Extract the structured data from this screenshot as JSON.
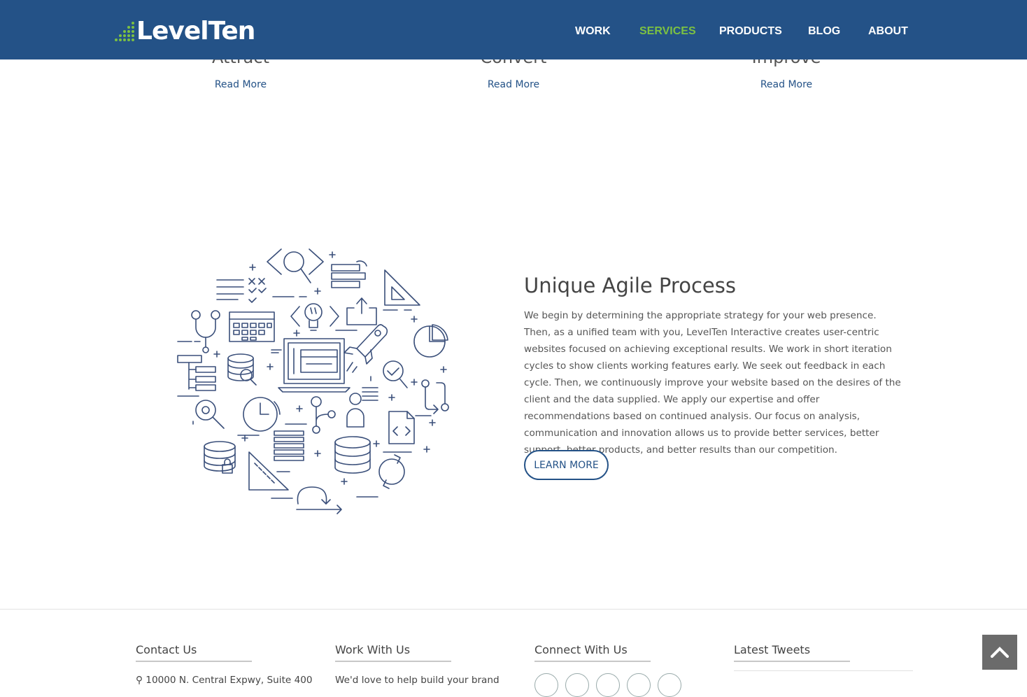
{
  "header": {
    "logo_text": "LevelTen",
    "nav": [
      {
        "label": "WORK",
        "active": false
      },
      {
        "label": "SERVICES",
        "active": true
      },
      {
        "label": "PRODUCTS",
        "active": false
      },
      {
        "label": "BLOG",
        "active": false
      },
      {
        "label": "ABOUT",
        "active": false
      }
    ],
    "active_color": "#7cc142",
    "background": "#245287"
  },
  "services": [
    {
      "title": "Attract",
      "link": "Read More"
    },
    {
      "title": "Convert",
      "link": "Read More"
    },
    {
      "title": "Improve",
      "link": "Read More"
    }
  ],
  "agile": {
    "title": "Unique Agile Process",
    "body": "We begin by determining the appropriate strategy for your web presence. Then, as a unified team with you, LevelTen Interactive creates user-centric websites focused on achieving exceptional results. We work in short iteration cycles to show clients working features early. We seek out feedback in each cycle. Then, we continuously improve your website based on the desires of the client and the data supplied. We apply our expertise and offer recommendations based on continued analysis. Our focus on analysis, communication and innovation allows us to provide better services, better support, better products, and better results than our competition.",
    "button": "LEARN MORE"
  },
  "footer": {
    "contact": {
      "heading": "Contact Us",
      "address": "10000 N. Central Expwy, Suite 400"
    },
    "work": {
      "heading": "Work With Us",
      "text": "We'd love to help build your brand"
    },
    "connect": {
      "heading": "Connect With Us"
    },
    "tweets": {
      "heading": "Latest Tweets"
    }
  }
}
